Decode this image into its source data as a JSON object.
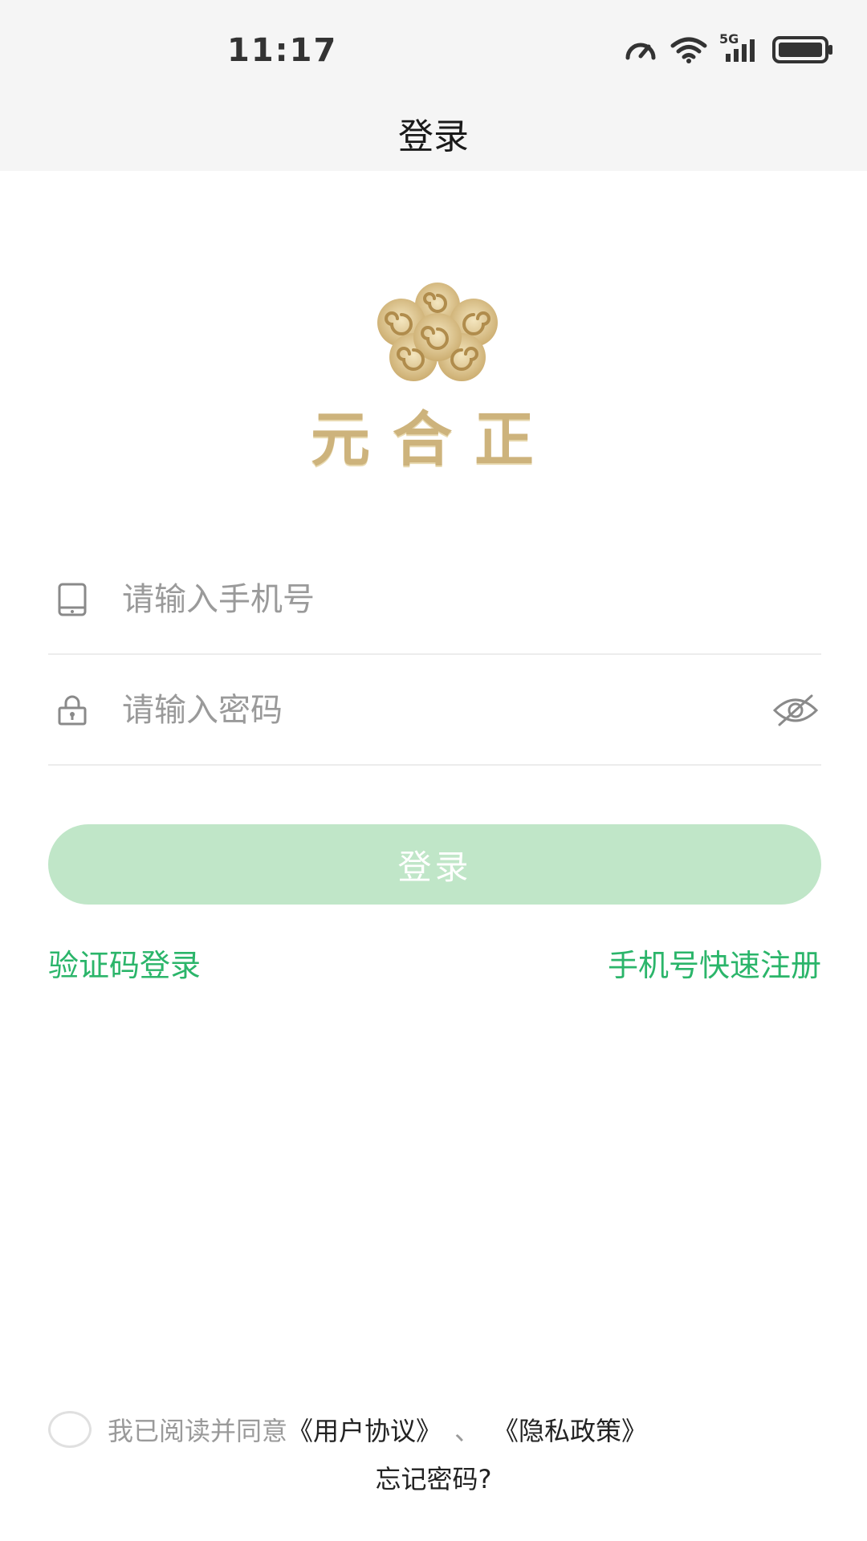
{
  "status_bar": {
    "time": "11:17",
    "icons": [
      "speed-meter-icon",
      "wifi-icon",
      "signal-5g-icon",
      "battery-icon"
    ],
    "network_label": "5G"
  },
  "nav": {
    "title": "登录"
  },
  "logo": {
    "text": "元合正",
    "color": "#cdb37c"
  },
  "form": {
    "phone": {
      "placeholder": "请输入手机号",
      "value": "",
      "icon": "phone-icon"
    },
    "password": {
      "placeholder": "请输入密码",
      "value": "",
      "icon": "lock-icon",
      "toggle_icon": "eye-off-icon"
    },
    "login_label": "登录"
  },
  "links": {
    "code_login": "验证码登录",
    "register": "手机号快速注册"
  },
  "agreement": {
    "prefix": "我已阅读并同意",
    "user_agreement": "《用户协议》",
    "separator": "、",
    "privacy_policy": "《隐私政策》",
    "checked": false
  },
  "forgot_password": "忘记密码?",
  "colors": {
    "accent_green": "#2bb56a",
    "button_disabled": "#c0e6c8",
    "header_bg": "#f5f5f5"
  }
}
